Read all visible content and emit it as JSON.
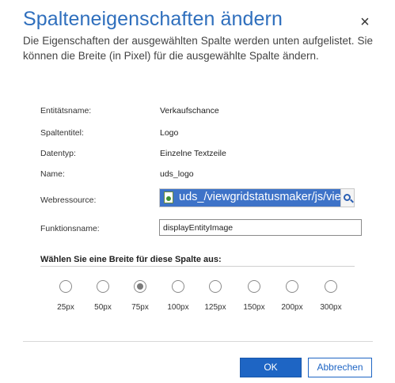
{
  "dialog": {
    "title": "Spalteneigenschaften ändern",
    "close_icon": "close-icon",
    "description": "Die Eigenschaften der ausgewählten Spalte werden unten aufgelistet. Sie können die Breite (in Pixel) für die ausgewählte Spalte ändern."
  },
  "properties": {
    "entity_label": "Entitätsname:",
    "entity_value": "Verkaufschance",
    "column_title_label": "Spaltentitel:",
    "column_title_value": "Logo",
    "datatype_label": "Datentyp:",
    "datatype_value": "Einzelne Textzeile",
    "name_label": "Name:",
    "name_value": "uds_logo",
    "webresource_label": "Webressource:",
    "webresource_value": "uds_/viewgridstatusmaker/js/vie",
    "webresource_icon": "script-file-icon",
    "lookup_icon": "lookup-search-icon",
    "function_label": "Funktionsname:",
    "function_value": "displayEntityImage"
  },
  "width": {
    "heading": "Wählen Sie eine Breite für diese Spalte aus:",
    "selected": "75px",
    "options": [
      "25px",
      "50px",
      "75px",
      "100px",
      "125px",
      "150px",
      "200px",
      "300px"
    ]
  },
  "footer": {
    "ok_label": "OK",
    "cancel_label": "Abbrechen"
  },
  "colors": {
    "title": "#2f6fbd",
    "primary_button": "#1e65c4",
    "selection_highlight": "#3e73c8"
  }
}
